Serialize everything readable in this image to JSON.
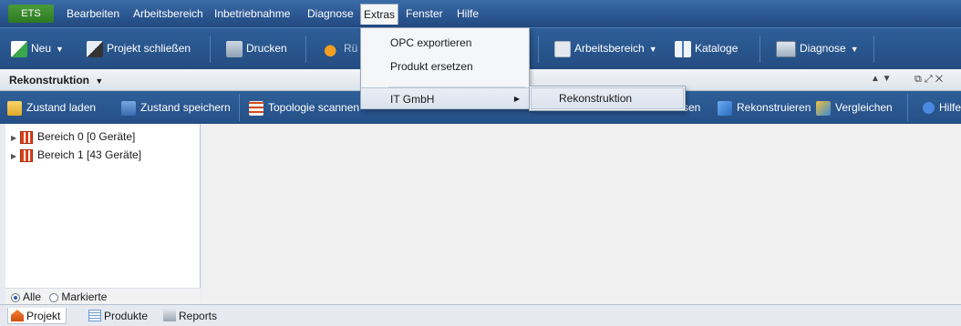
{
  "menubar": {
    "app_button": "ETS",
    "items": [
      "Bearbeiten",
      "Arbeitsbereich",
      "Inbetriebnahme",
      "Diagnose",
      "Extras",
      "Fenster",
      "Hilfe"
    ]
  },
  "toolbar": {
    "neu": "Neu",
    "projekt_schliessen": "Projekt schließen",
    "drucken": "Drucken",
    "rueckgaengig_partial": "Rü",
    "arbeitsbereich": "Arbeitsbereich",
    "kataloge": "Kataloge",
    "diagnose": "Diagnose"
  },
  "panel": {
    "title": "Rekonstruktion",
    "title_arrow": "▼",
    "updown": "▲ ▼",
    "window_controls": "⧉ ⤢ ✕"
  },
  "subtoolbar": {
    "zustand_laden": "Zustand laden",
    "zustand_speichern": "Zustand speichern",
    "topologie_scannen": "Topologie scannen",
    "lesen_partial": "sen",
    "rekonstruieren": "Rekonstruieren",
    "vergleichen": "Vergleichen",
    "hilfe_partial": "Hilfe"
  },
  "tree": {
    "items": [
      {
        "label": "Bereich 0 [0 Geräte]"
      },
      {
        "label": "Bereich 1 [43 Geräte]"
      }
    ]
  },
  "filter": {
    "alle": "Alle",
    "markierte": "Markierte"
  },
  "tabs": [
    "Projekt",
    "Produkte",
    "Reports"
  ],
  "extras_menu": {
    "items": [
      "OPC exportieren",
      "Produkt ersetzen",
      "IT GmbH"
    ],
    "submenu_item": "Rekonstruktion"
  },
  "colors": {
    "menubar": "#2a5590",
    "toolbar": "#2e5e98",
    "ets_button": "#3a8a2e"
  }
}
